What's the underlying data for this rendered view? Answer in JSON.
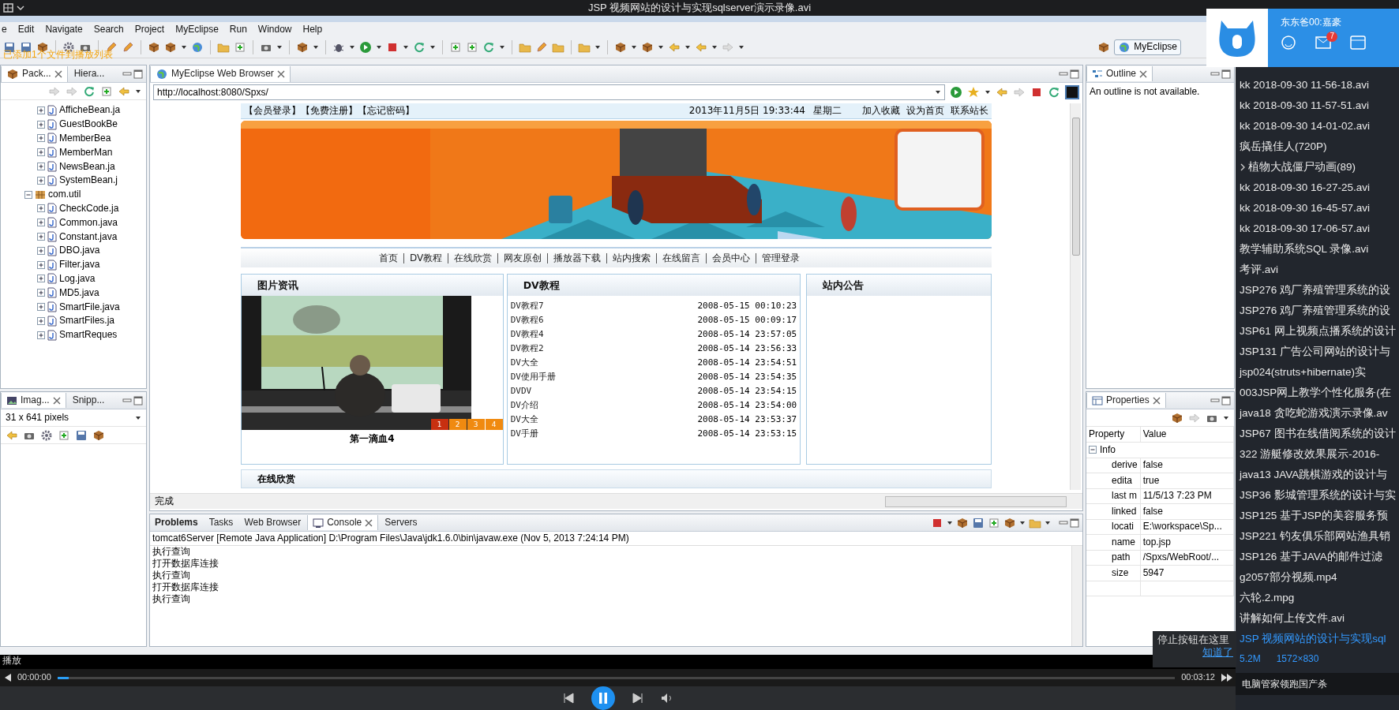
{
  "title_bar": {
    "title": "JSP 视频网站的设计与实现sqlserver演示录像.avi"
  },
  "osd_message": "已添加1个文件到播放列表",
  "menu": [
    "e",
    "Edit",
    "Navigate",
    "Search",
    "Project",
    "MyEclipse",
    "Run",
    "Window",
    "Help"
  ],
  "perspective": {
    "label": "MyEclipse"
  },
  "package_explorer": {
    "tabs": [
      {
        "label": "Pack...",
        "selected": true
      },
      {
        "label": "Hiera...",
        "selected": false
      }
    ],
    "tree": [
      {
        "label": "AfficheBean.ja",
        "kind": "class",
        "expanded": false
      },
      {
        "label": "GuestBookBe",
        "kind": "class",
        "expanded": false
      },
      {
        "label": "MemberBea",
        "kind": "class",
        "expanded": false
      },
      {
        "label": "MemberMan",
        "kind": "class",
        "expanded": false
      },
      {
        "label": "NewsBean.ja",
        "kind": "class",
        "expanded": false
      },
      {
        "label": "SystemBean.j",
        "kind": "class",
        "expanded": false
      },
      {
        "label": "com.util",
        "kind": "package",
        "expanded": true,
        "children": [
          {
            "label": "CheckCode.ja",
            "kind": "class",
            "expanded": false
          },
          {
            "label": "Common.java",
            "kind": "class",
            "expanded": false
          },
          {
            "label": "Constant.java",
            "kind": "class",
            "expanded": false
          },
          {
            "label": "DBO.java",
            "kind": "class",
            "expanded": false
          },
          {
            "label": "Filter.java",
            "kind": "class",
            "expanded": false
          },
          {
            "label": "Log.java",
            "kind": "class",
            "expanded": false
          },
          {
            "label": "MD5.java",
            "kind": "class",
            "expanded": false
          },
          {
            "label": "SmartFile.java",
            "kind": "class",
            "expanded": false
          },
          {
            "label": "SmartFiles.ja",
            "kind": "class",
            "expanded": false
          },
          {
            "label": "SmartReques",
            "kind": "class",
            "expanded": false
          }
        ]
      }
    ]
  },
  "image_view": {
    "tabs": [
      {
        "label": "Imag...",
        "selected": true
      },
      {
        "label": "Snipp...",
        "selected": false
      }
    ],
    "info": "31 x 641 pixels"
  },
  "browser": {
    "tab": "MyEclipse Web Browser",
    "url": "http://localhost:8080/Spxs/",
    "status": "完成",
    "page": {
      "user_links": "【会员登录】【免费注册】【忘记密码】",
      "datetime": "2013年11月5日 19:33:44",
      "weekday": "星期二",
      "top_links": [
        "加入收藏",
        "设为首页",
        "联系站长"
      ],
      "nav": [
        "首页",
        "DV教程",
        "在线欣赏",
        "网友原创",
        "播放器下载",
        "站内搜索",
        "在线留言",
        "会员中心",
        "管理登录"
      ],
      "photo_news": {
        "title": "图片资讯",
        "caption": "第一滴血4",
        "slides": [
          {
            "label": "1",
            "selected": true
          },
          {
            "label": "2",
            "selected": false
          },
          {
            "label": "3",
            "selected": false
          },
          {
            "label": "4",
            "selected": false
          }
        ]
      },
      "dv_tutorials": {
        "title": "DV教程",
        "rows": [
          {
            "name": "DV教程7",
            "time": "2008-05-15 00:10:23"
          },
          {
            "name": "DV教程6",
            "time": "2008-05-15 00:09:17"
          },
          {
            "name": "DV教程4",
            "time": "2008-05-14 23:57:05"
          },
          {
            "name": "DV教程2",
            "time": "2008-05-14 23:56:33"
          },
          {
            "name": "DV大全",
            "time": "2008-05-14 23:54:51"
          },
          {
            "name": "DV使用手册",
            "time": "2008-05-14 23:54:35"
          },
          {
            "name": "DVDV",
            "time": "2008-05-14 23:54:15"
          },
          {
            "name": "DV介绍",
            "time": "2008-05-14 23:54:00"
          },
          {
            "name": "DV大全",
            "time": "2008-05-14 23:53:37"
          },
          {
            "name": "DV手册",
            "time": "2008-05-14 23:53:15"
          }
        ]
      },
      "notice": {
        "title": "站内公告"
      },
      "online_section": {
        "title": "在线欣赏"
      }
    }
  },
  "console": {
    "tabs": [
      {
        "label": "Problems",
        "selected": false
      },
      {
        "label": "Tasks",
        "selected": false
      },
      {
        "label": "Web Browser",
        "selected": false
      },
      {
        "label": "Console",
        "selected": true
      },
      {
        "label": "Servers",
        "selected": false
      }
    ],
    "process": "tomcat6Server [Remote Java Application] D:\\Program Files\\Java\\jdk1.6.0\\bin\\javaw.exe (Nov 5, 2013 7:24:14 PM)",
    "lines": [
      "执行查询",
      "打开数据库连接",
      "执行查询",
      "打开数据库连接",
      "执行查询"
    ]
  },
  "outline": {
    "title": "Outline",
    "message": "An outline is not available."
  },
  "properties": {
    "title": "Properties",
    "columns": [
      "Property",
      "Value"
    ],
    "group": {
      "label": "Info",
      "expanded": true,
      "rows": [
        {
          "property": "derive",
          "value": "false"
        },
        {
          "property": "edita",
          "value": "true"
        },
        {
          "property": "last m",
          "value": "11/5/13 7:23 PM"
        },
        {
          "property": "linked",
          "value": "false"
        },
        {
          "property": "locati",
          "value": "E:\\workspace\\Sp..."
        },
        {
          "property": "name",
          "value": "top.jsp"
        },
        {
          "property": "path",
          "value": "/Spxs/WebRoot/..."
        },
        {
          "property": "size",
          "value": "5947"
        }
      ]
    }
  },
  "notification": {
    "user": "东东爸00:嘉豪",
    "mail_count": "7"
  },
  "playlist": {
    "items": [
      {
        "label": "kk 2018-09-30 11-56-18.avi",
        "kind": "file",
        "selected": false
      },
      {
        "label": "kk 2018-09-30 11-57-51.avi",
        "kind": "file",
        "selected": false
      },
      {
        "label": "kk 2018-09-30 14-01-02.avi",
        "kind": "file",
        "selected": false
      },
      {
        "label": "疯岳撬佳人(720P)",
        "kind": "file",
        "selected": false
      },
      {
        "label": "植物大战僵尸动画(89)",
        "kind": "folder",
        "selected": false
      },
      {
        "label": "kk 2018-09-30 16-27-25.avi",
        "kind": "file",
        "selected": false
      },
      {
        "label": "kk 2018-09-30 16-45-57.avi",
        "kind": "file",
        "selected": false
      },
      {
        "label": "kk 2018-09-30 17-06-57.avi",
        "kind": "file",
        "selected": false
      },
      {
        "label": "教学辅助系统SQL 录像.avi",
        "kind": "file",
        "selected": false
      },
      {
        "label": "考评.avi",
        "kind": "file",
        "selected": false
      },
      {
        "label": "JSP276 鸡厂养殖管理系统的设",
        "kind": "file",
        "selected": false
      },
      {
        "label": "JSP276 鸡厂养殖管理系统的设",
        "kind": "file",
        "selected": false
      },
      {
        "label": "JSP61 网上视频点播系统的设计",
        "kind": "file",
        "selected": false
      },
      {
        "label": "JSP131 广告公司网站的设计与",
        "kind": "file",
        "selected": false
      },
      {
        "label": "jsp024(struts+hibernate)实",
        "kind": "file",
        "selected": false
      },
      {
        "label": "003JSP网上教学个性化服务(在",
        "kind": "file",
        "selected": false
      },
      {
        "label": "java18 贪吃蛇游戏演示录像.av",
        "kind": "file",
        "selected": false
      },
      {
        "label": "JSP67 图书在线借阅系统的设计",
        "kind": "file",
        "selected": false
      },
      {
        "label": "322 游艇修改效果展示-2016-",
        "kind": "file",
        "selected": false
      },
      {
        "label": "java13 JAVA跳棋游戏的设计与",
        "kind": "file",
        "selected": false
      },
      {
        "label": "JSP36 影城管理系统的设计与实",
        "kind": "file",
        "selected": false
      },
      {
        "label": "JSP125 基于JSP的美容服务预",
        "kind": "file",
        "selected": false
      },
      {
        "label": "JSP221 钓友俱乐部网站渔具销",
        "kind": "file",
        "selected": false
      },
      {
        "label": "JSP126 基于JAVA的邮件过滤",
        "kind": "file",
        "selected": false
      },
      {
        "label": "g2057部分视频.mp4",
        "kind": "file",
        "selected": false
      },
      {
        "label": "六轮.2.mpg",
        "kind": "file",
        "selected": false
      },
      {
        "label": "讲解如何上传文件.avi",
        "kind": "file",
        "selected": false
      },
      {
        "label": "JSP 视频网站的设计与实现sql",
        "kind": "file",
        "selected": true
      }
    ],
    "size": "5.2M",
    "resolution": "1572×830",
    "ad": "电脑管家领跑国产杀"
  },
  "tooltip": {
    "text": "停止按钮在这里",
    "link": "知道了"
  },
  "player": {
    "state": "播放",
    "elapsed": "00:00:00",
    "duration": "00:03:12",
    "level": 0.01
  }
}
